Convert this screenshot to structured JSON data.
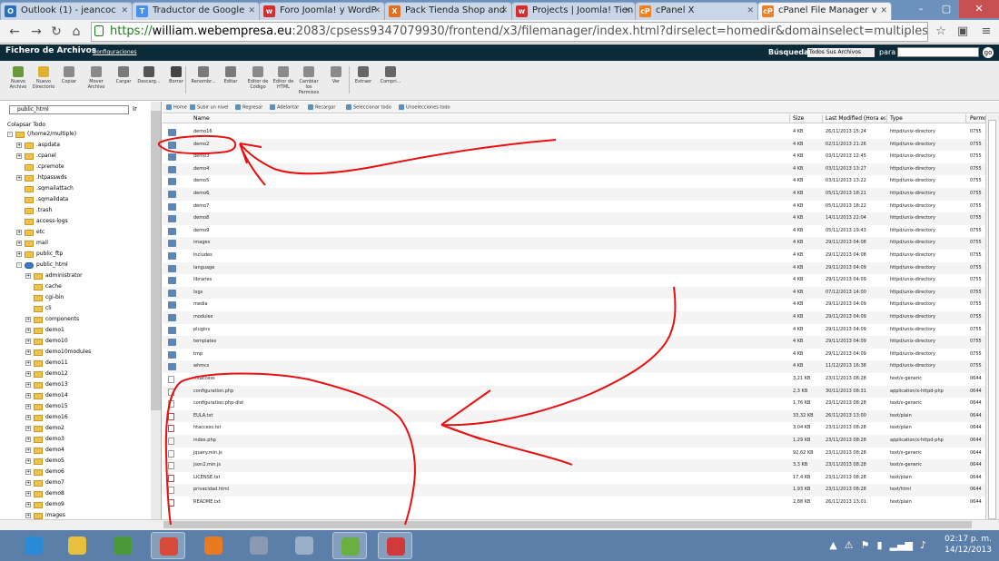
{
  "browser": {
    "tabs": [
      {
        "title": "Outlook (1) - jeancoc",
        "icon": "outlook-icon",
        "color": "#2a6fbd",
        "glyph": "O"
      },
      {
        "title": "Traductor de Google",
        "icon": "translate-icon",
        "color": "#4a8ef0",
        "glyph": "T"
      },
      {
        "title": "Foro Joomla! y WordP",
        "icon": "webempresa-icon",
        "color": "#d23030",
        "glyph": "w"
      },
      {
        "title": "Pack Tienda Shop and",
        "icon": "pack-icon",
        "color": "#e07020",
        "glyph": "X"
      },
      {
        "title": "Projects | Joomla! Tien",
        "icon": "webempresa-icon",
        "color": "#d23030",
        "glyph": "w"
      },
      {
        "title": "cPanel X",
        "icon": "cpanel-icon",
        "color": "#f08020",
        "glyph": "cP"
      },
      {
        "title": "cPanel File Manager v",
        "icon": "cpanel-icon",
        "color": "#f08020",
        "glyph": "cP"
      }
    ],
    "url_prefix": "https://",
    "url_host": "william.webempresa.eu",
    "url_rest": ":2083/cpsess9347079930/frontend/x3/filemanager/index.html?dirselect=homedir&domainselect=multipleservicios.com&d"
  },
  "fm": {
    "title": "Fichero de Archivos",
    "config_link": "Configuraciones",
    "search_label": "Búsqueda",
    "search_scope": "Todos Sus Archivos",
    "search_for_label": "para"
  },
  "toolbar": [
    {
      "label": "Nuevo Archivo",
      "icon": "new-file-icon",
      "color": "#6a9a3a"
    },
    {
      "label": "Nuevo Directorio",
      "icon": "new-folder-icon",
      "color": "#e0b030"
    },
    {
      "label": "Copiar",
      "icon": "copy-icon",
      "color": "#8a8a8a"
    },
    {
      "label": "Mover Archivo",
      "icon": "move-icon",
      "color": "#8a8a8a"
    },
    {
      "label": "Cargar",
      "icon": "upload-icon",
      "color": "#7a7a7a"
    },
    {
      "label": "Descarg...",
      "icon": "download-icon",
      "color": "#555555"
    },
    {
      "label": "Borrar",
      "icon": "delete-icon",
      "color": "#444444"
    },
    {
      "label": "Renombr...",
      "icon": "rename-icon",
      "color": "#7a7a7a"
    },
    {
      "label": "Editar",
      "icon": "edit-icon",
      "color": "#7a7a7a"
    },
    {
      "label": "Editor de Código",
      "icon": "code-editor-icon",
      "color": "#8a8a8a"
    },
    {
      "label": "Editor de HTML",
      "icon": "html-editor-icon",
      "color": "#8a8a8a"
    },
    {
      "label": "Cambiar los Permisos",
      "icon": "permissions-icon",
      "color": "#8a8a8a"
    },
    {
      "label": "Ver",
      "icon": "view-icon",
      "color": "#8a8a8a"
    },
    {
      "label": "Extraer",
      "icon": "extract-icon",
      "color": "#666666"
    },
    {
      "label": "Compri...",
      "icon": "compress-icon",
      "color": "#666666"
    }
  ],
  "sidebar": {
    "path": "public_html",
    "collapse_label": "Colapsar Todo",
    "tree": [
      {
        "label": "(/home2/multiple)",
        "level": 0,
        "pm": "-",
        "kind": "home"
      },
      {
        "label": ".aspdata",
        "level": 1,
        "pm": "+"
      },
      {
        "label": ".cpanel",
        "level": 1,
        "pm": "+"
      },
      {
        "label": ".cpremote",
        "level": 1,
        "pm": ""
      },
      {
        "label": ".htpasswds",
        "level": 1,
        "pm": "+"
      },
      {
        "label": ".sqmailattach",
        "level": 1,
        "pm": ""
      },
      {
        "label": ".sqmaildata",
        "level": 1,
        "pm": ""
      },
      {
        "label": ".trash",
        "level": 1,
        "pm": ""
      },
      {
        "label": "access-logs",
        "level": 1,
        "pm": ""
      },
      {
        "label": "etc",
        "level": 1,
        "pm": "+"
      },
      {
        "label": "mail",
        "level": 1,
        "pm": "+"
      },
      {
        "label": "public_ftp",
        "level": 1,
        "pm": "+"
      },
      {
        "label": "public_html",
        "level": 1,
        "pm": "-",
        "kind": "globe"
      },
      {
        "label": "administrator",
        "level": 2,
        "pm": "+"
      },
      {
        "label": "cache",
        "level": 2,
        "pm": ""
      },
      {
        "label": "cgi-bin",
        "level": 2,
        "pm": ""
      },
      {
        "label": "cli",
        "level": 2,
        "pm": ""
      },
      {
        "label": "components",
        "level": 2,
        "pm": "+"
      },
      {
        "label": "demo1",
        "level": 2,
        "pm": "+"
      },
      {
        "label": "demo10",
        "level": 2,
        "pm": "+"
      },
      {
        "label": "demo10modules",
        "level": 2,
        "pm": "+"
      },
      {
        "label": "demo11",
        "level": 2,
        "pm": "+"
      },
      {
        "label": "demo12",
        "level": 2,
        "pm": "+"
      },
      {
        "label": "demo13",
        "level": 2,
        "pm": "+"
      },
      {
        "label": "demo14",
        "level": 2,
        "pm": "+"
      },
      {
        "label": "demo15",
        "level": 2,
        "pm": "+"
      },
      {
        "label": "demo16",
        "level": 2,
        "pm": "+"
      },
      {
        "label": "demo2",
        "level": 2,
        "pm": "+"
      },
      {
        "label": "demo3",
        "level": 2,
        "pm": "+"
      },
      {
        "label": "demo4",
        "level": 2,
        "pm": "+"
      },
      {
        "label": "demo5",
        "level": 2,
        "pm": "+"
      },
      {
        "label": "demo6",
        "level": 2,
        "pm": "+"
      },
      {
        "label": "demo7",
        "level": 2,
        "pm": "+"
      },
      {
        "label": "demo8",
        "level": 2,
        "pm": "+"
      },
      {
        "label": "demo9",
        "level": 2,
        "pm": "+"
      },
      {
        "label": "images",
        "level": 2,
        "pm": "+"
      }
    ]
  },
  "actions": [
    {
      "label": "Home",
      "icon": "home-icon"
    },
    {
      "label": "Subir un nivel",
      "icon": "up-level-icon"
    },
    {
      "label": "Regresar",
      "icon": "back-icon"
    },
    {
      "label": "Adelantar",
      "icon": "forward-icon"
    },
    {
      "label": "Recargar",
      "icon": "reload-icon"
    },
    {
      "label": "Seleccionar todo",
      "icon": "select-all-icon"
    },
    {
      "label": "Unselecciones todo",
      "icon": "unselect-all-icon"
    }
  ],
  "columns": {
    "name": "Name",
    "size": "Size",
    "modified": "Last Modified (Hora está",
    "type": "Type",
    "perms": "Perms"
  },
  "files": [
    {
      "name": "demo16",
      "size": "4 KB",
      "modified": "26/11/2013 15:24",
      "type": "httpd/unix-directory",
      "perms": "0755",
      "kind": "folder"
    },
    {
      "name": "demo2",
      "size": "4 KB",
      "modified": "02/11/2013 21:26",
      "type": "httpd/unix-directory",
      "perms": "0755",
      "kind": "folder"
    },
    {
      "name": "demo3",
      "size": "4 KB",
      "modified": "03/11/2013 12:45",
      "type": "httpd/unix-directory",
      "perms": "0755",
      "kind": "folder"
    },
    {
      "name": "demo4",
      "size": "4 KB",
      "modified": "03/11/2013 13:27",
      "type": "httpd/unix-directory",
      "perms": "0755",
      "kind": "folder"
    },
    {
      "name": "demo5",
      "size": "4 KB",
      "modified": "03/11/2013 13:22",
      "type": "httpd/unix-directory",
      "perms": "0755",
      "kind": "folder"
    },
    {
      "name": "demo6",
      "size": "4 KB",
      "modified": "05/11/2013 18:21",
      "type": "httpd/unix-directory",
      "perms": "0755",
      "kind": "folder"
    },
    {
      "name": "demo7",
      "size": "4 KB",
      "modified": "05/11/2013 18:22",
      "type": "httpd/unix-directory",
      "perms": "0755",
      "kind": "folder"
    },
    {
      "name": "demo8",
      "size": "4 KB",
      "modified": "14/11/2013 22:04",
      "type": "httpd/unix-directory",
      "perms": "0755",
      "kind": "folder"
    },
    {
      "name": "demo9",
      "size": "4 KB",
      "modified": "05/11/2013 19:43",
      "type": "httpd/unix-directory",
      "perms": "0755",
      "kind": "folder"
    },
    {
      "name": "images",
      "size": "4 KB",
      "modified": "29/11/2013 04:08",
      "type": "httpd/unix-directory",
      "perms": "0755",
      "kind": "folder"
    },
    {
      "name": "includes",
      "size": "4 KB",
      "modified": "29/11/2013 04:08",
      "type": "httpd/unix-directory",
      "perms": "0755",
      "kind": "folder"
    },
    {
      "name": "language",
      "size": "4 KB",
      "modified": "29/11/2013 04:09",
      "type": "httpd/unix-directory",
      "perms": "0755",
      "kind": "folder"
    },
    {
      "name": "libraries",
      "size": "4 KB",
      "modified": "29/11/2013 04:09",
      "type": "httpd/unix-directory",
      "perms": "0755",
      "kind": "folder"
    },
    {
      "name": "logs",
      "size": "4 KB",
      "modified": "07/12/2013 14:00",
      "type": "httpd/unix-directory",
      "perms": "0755",
      "kind": "folder"
    },
    {
      "name": "media",
      "size": "4 KB",
      "modified": "29/11/2013 04:09",
      "type": "httpd/unix-directory",
      "perms": "0755",
      "kind": "folder"
    },
    {
      "name": "modules",
      "size": "4 KB",
      "modified": "29/11/2013 04:09",
      "type": "httpd/unix-directory",
      "perms": "0755",
      "kind": "folder"
    },
    {
      "name": "plugins",
      "size": "4 KB",
      "modified": "29/11/2013 04:09",
      "type": "httpd/unix-directory",
      "perms": "0755",
      "kind": "folder"
    },
    {
      "name": "templates",
      "size": "4 KB",
      "modified": "29/11/2013 04:09",
      "type": "httpd/unix-directory",
      "perms": "0755",
      "kind": "folder"
    },
    {
      "name": "tmp",
      "size": "4 KB",
      "modified": "29/11/2013 04:09",
      "type": "httpd/unix-directory",
      "perms": "0755",
      "kind": "folder"
    },
    {
      "name": "whmcs",
      "size": "4 KB",
      "modified": "11/12/2013 16:38",
      "type": "httpd/unix-directory",
      "perms": "0755",
      "kind": "folder"
    },
    {
      "name": ".htaccess",
      "size": "3,21 KB",
      "modified": "23/11/2013 08:28",
      "type": "text/x-generic",
      "perms": "0644",
      "kind": "file"
    },
    {
      "name": "configuration.php",
      "size": "2,3 KB",
      "modified": "30/11/2013 08:31",
      "type": "application/x-httpd-php",
      "perms": "0644",
      "kind": "php"
    },
    {
      "name": "configuration.php-dist",
      "size": "1,76 KB",
      "modified": "23/11/2013 08:28",
      "type": "text/x-generic",
      "perms": "0644",
      "kind": "file"
    },
    {
      "name": "EULA.txt",
      "size": "33,32 KB",
      "modified": "26/11/2013 13:00",
      "type": "text/plain",
      "perms": "0644",
      "kind": "text"
    },
    {
      "name": "htaccess.txt",
      "size": "3,04 KB",
      "modified": "23/11/2013 08:28",
      "type": "text/plain",
      "perms": "0644",
      "kind": "text"
    },
    {
      "name": "index.php",
      "size": "1,29 KB",
      "modified": "23/11/2013 08:28",
      "type": "application/x-httpd-php",
      "perms": "0644",
      "kind": "php"
    },
    {
      "name": "jquery.min.js",
      "size": "92,62 KB",
      "modified": "23/11/2013 08:28",
      "type": "text/x-generic",
      "perms": "0644",
      "kind": "file"
    },
    {
      "name": "json2.min.js",
      "size": "3,3 KB",
      "modified": "23/11/2013 08:28",
      "type": "text/x-generic",
      "perms": "0644",
      "kind": "file"
    },
    {
      "name": "LICENSE.txt",
      "size": "17,4 KB",
      "modified": "23/11/2013 08:28",
      "type": "text/plain",
      "perms": "0644",
      "kind": "text"
    },
    {
      "name": "privacidad.html",
      "size": "1,93 KB",
      "modified": "23/11/2013 08:28",
      "type": "text/html",
      "perms": "0644",
      "kind": "file"
    },
    {
      "name": "README.txt",
      "size": "2,88 KB",
      "modified": "26/11/2013 13:01",
      "type": "text/plain",
      "perms": "0644",
      "kind": "text"
    }
  ],
  "taskbar": {
    "apps": [
      {
        "name": "ie-icon",
        "color": "#2a8ad8",
        "open": false
      },
      {
        "name": "explorer-icon",
        "color": "#e8c040",
        "open": false
      },
      {
        "name": "word-icon",
        "color": "#4a9a3a",
        "open": false
      },
      {
        "name": "chrome-icon",
        "color": "#d84a3a",
        "open": true
      },
      {
        "name": "firefox-icon",
        "color": "#e87a20",
        "open": false
      },
      {
        "name": "scanner-icon",
        "color": "#8a9ab0",
        "open": false
      },
      {
        "name": "calculator-icon",
        "color": "#9ab0c8",
        "open": false
      },
      {
        "name": "notepad-icon",
        "color": "#6ab040",
        "open": true
      },
      {
        "name": "snagit-icon",
        "color": "#d03a3a",
        "open": true
      }
    ],
    "time": "02:17 p. m.",
    "date": "14/12/2013"
  }
}
